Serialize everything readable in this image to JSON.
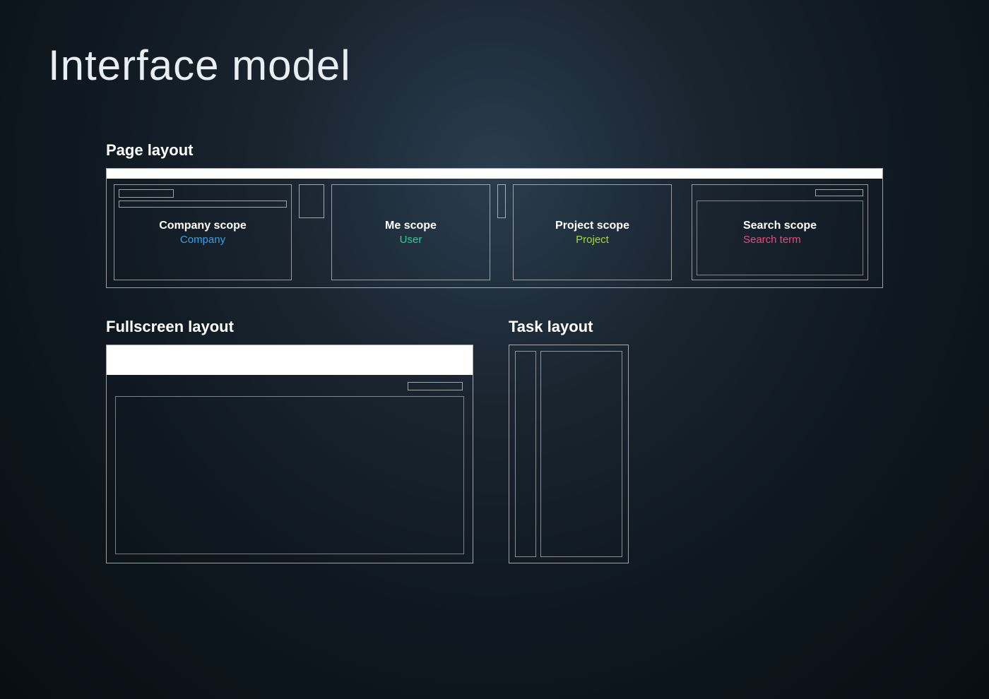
{
  "title": "Interface model",
  "sections": {
    "page_layout": {
      "heading": "Page layout",
      "scopes": [
        {
          "title": "Company scope",
          "subtitle": "Company",
          "color": "blue"
        },
        {
          "title": "Me scope",
          "subtitle": "User",
          "color": "teal"
        },
        {
          "title": "Project scope",
          "subtitle": "Project",
          "color": "lime"
        },
        {
          "title": "Search scope",
          "subtitle": "Search term",
          "color": "pink"
        }
      ]
    },
    "fullscreen_layout": {
      "heading": "Fullscreen layout"
    },
    "task_layout": {
      "heading": "Task layout"
    }
  },
  "colors": {
    "blue": "#3aa0e8",
    "teal": "#2fcf9b",
    "lime": "#a4d93a",
    "pink": "#e84a7d"
  }
}
